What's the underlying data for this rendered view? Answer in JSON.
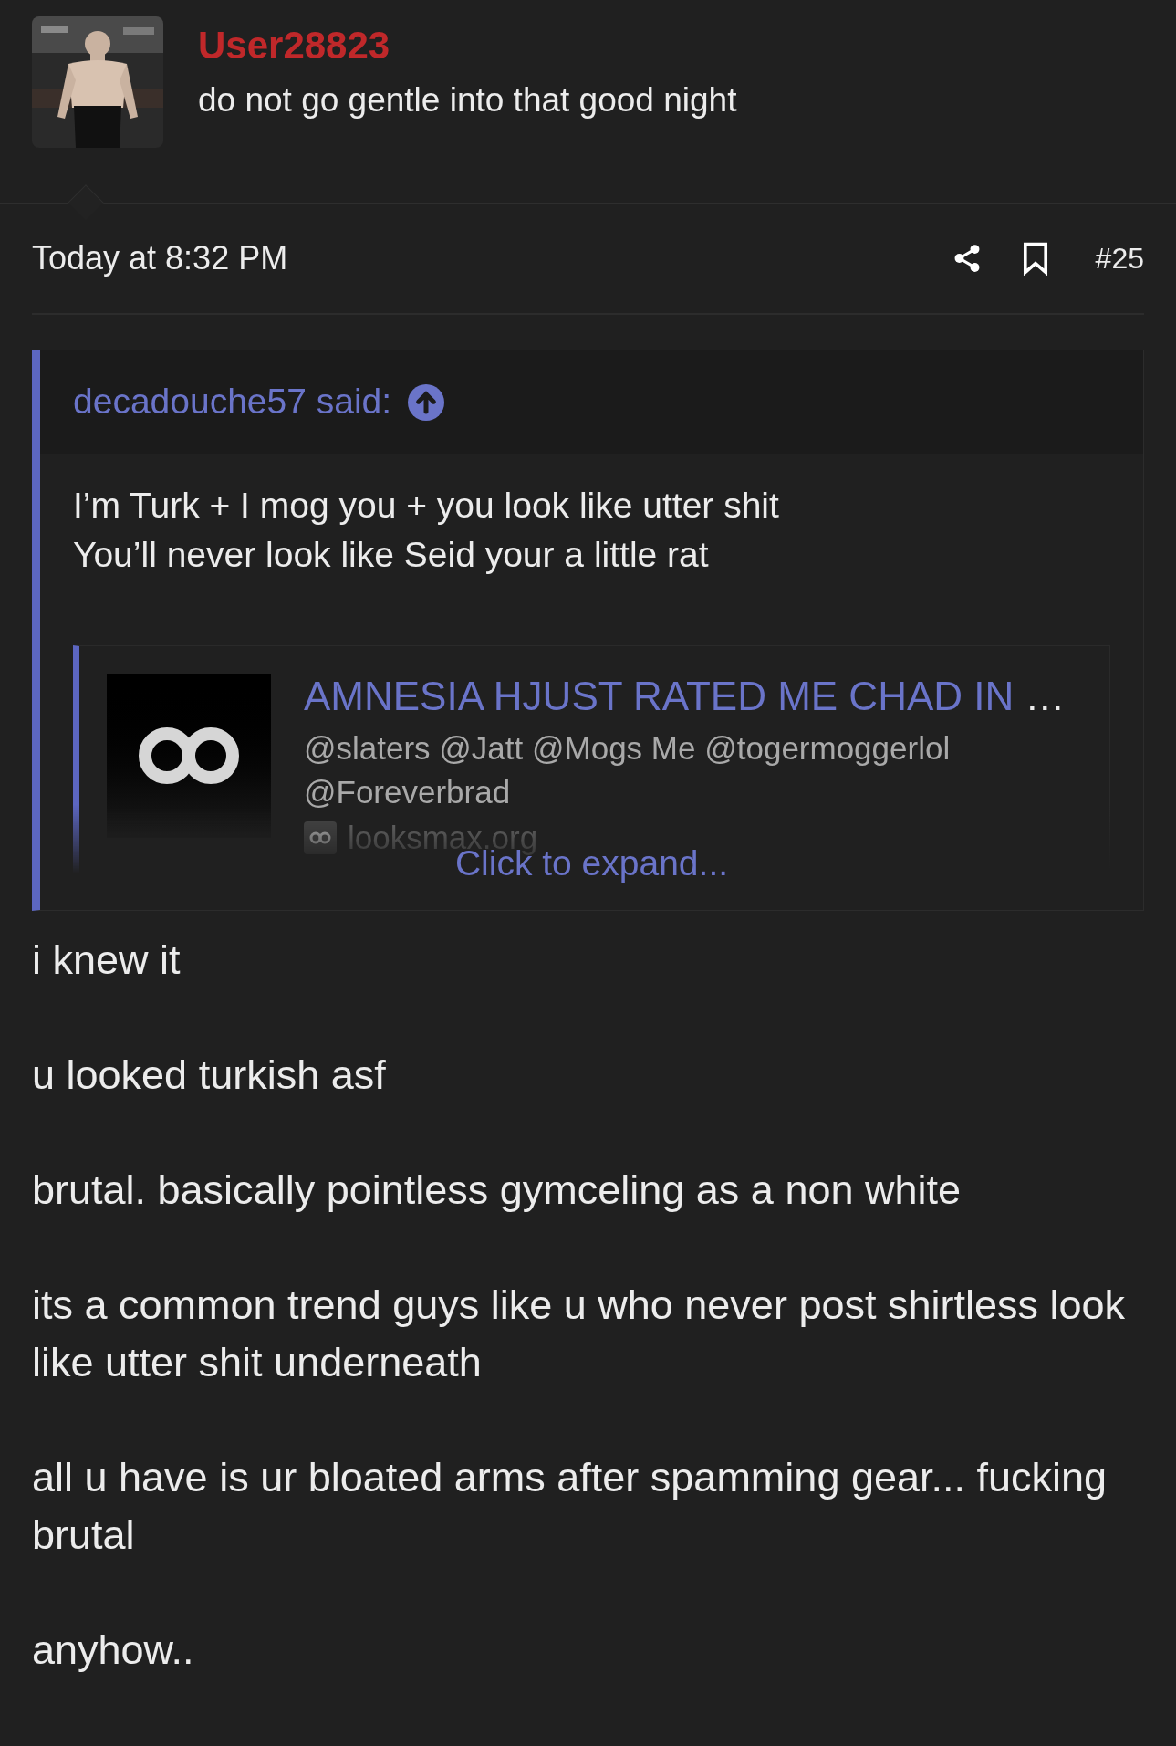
{
  "post": {
    "author": {
      "username": "User28823",
      "tagline": "do not go gentle into that good night"
    },
    "date": "Today at 8:32 PM",
    "number": "#25",
    "quote": {
      "author": "decadouche57 said:",
      "lines": [
        "I’m Turk + I mog you + you look like utter shit",
        "You’ll never look like Seid your a little rat"
      ],
      "embed": {
        "title": "AMNESIA HJUST RATED ME CHAD IN",
        "ellipsis": "…",
        "description": "@slaters @Jatt @Mogs Me @togermoggerlol @Foreverbrad",
        "site": "looksmax.org"
      },
      "expand": "Click to expand..."
    },
    "paragraphs": [
      "i knew it",
      "u looked turkish asf",
      "brutal. basically pointless gymceling as a non white",
      "its a common trend guys like u who never post shirtless look like utter shit underneath",
      "all u have is ur bloated arms after spamming gear... fucking brutal",
      "anyhow.."
    ]
  }
}
